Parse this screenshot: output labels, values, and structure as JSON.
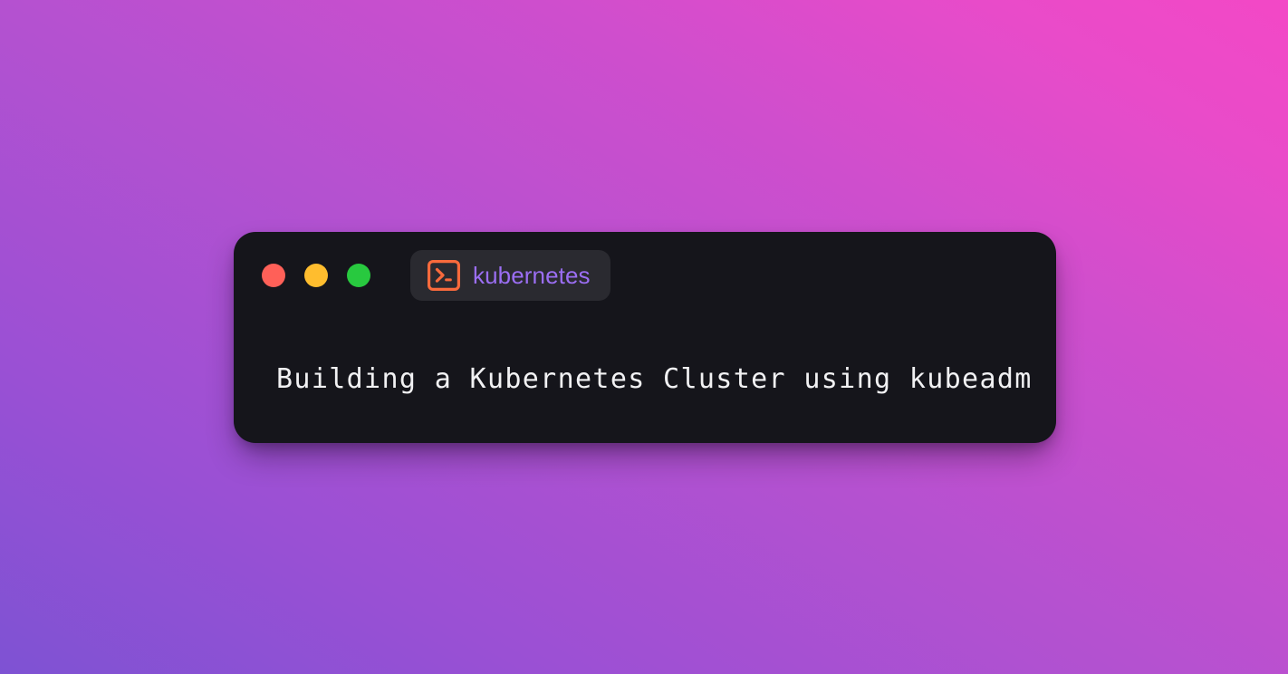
{
  "background": {
    "gradient_from": "#7e52d3",
    "gradient_mid": "#b551d0",
    "gradient_to": "#f348c6"
  },
  "window": {
    "background_color": "#15151b",
    "traffic_lights": [
      {
        "name": "close",
        "color": "#ff6058"
      },
      {
        "name": "minimize",
        "color": "#ffbd2e"
      },
      {
        "name": "maximize",
        "color": "#28c93f"
      }
    ],
    "tab": {
      "icon": "terminal-icon",
      "icon_color": "#f96a3c",
      "label": "kubernetes",
      "label_color": "#9b6ef3",
      "background_color": "#2a2a30"
    },
    "content": {
      "title": "Building a Kubernetes Cluster using kubeadm",
      "title_color": "#f1f1f3"
    }
  }
}
